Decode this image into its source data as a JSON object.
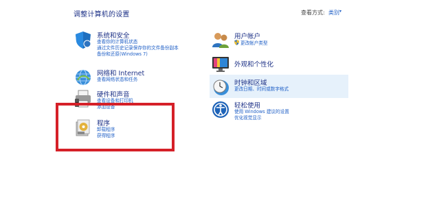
{
  "page": {
    "title": "调整计算机的设置",
    "view_by_label": "查看方式:",
    "view_by_value": "类别",
    "view_by_chevron": "▾"
  },
  "categories": [
    {
      "name": "系统和安全",
      "icon": "shield-icon",
      "links": [
        "查看你的计算机状态",
        "通过文件历史记录保存你的文件备份副本",
        "备份和还原(Windows 7)"
      ]
    },
    {
      "name": "网络和 Internet",
      "icon": "network-globe-icon",
      "links": [
        "查看网络状态和任务"
      ]
    },
    {
      "name": "硬件和声音",
      "icon": "printer-speaker-icon",
      "links": [
        "查看设备和打印机",
        "添加设备"
      ]
    },
    {
      "name": "程序",
      "icon": "programs-disc-icon",
      "links": [
        "卸载程序",
        "获得程序"
      ]
    },
    {
      "name": "用户帐户",
      "icon": "users-icon",
      "links": [
        "更改帐户类型"
      ]
    },
    {
      "name": "外观和个性化",
      "icon": "monitor-palette-icon",
      "links": []
    },
    {
      "name": "时钟和区域",
      "icon": "clock-globe-icon",
      "links": [
        "更改日期、时间或数字格式"
      ]
    },
    {
      "name": "轻松使用",
      "icon": "ease-of-access-icon",
      "links": [
        "使用 Windows 建议的设置",
        "优化视觉显示"
      ]
    }
  ],
  "colors": {
    "heading": "#1e3287",
    "link": "#1f5fc6",
    "highlight": "#e6f1fb",
    "annotation_box": "#d52028"
  }
}
